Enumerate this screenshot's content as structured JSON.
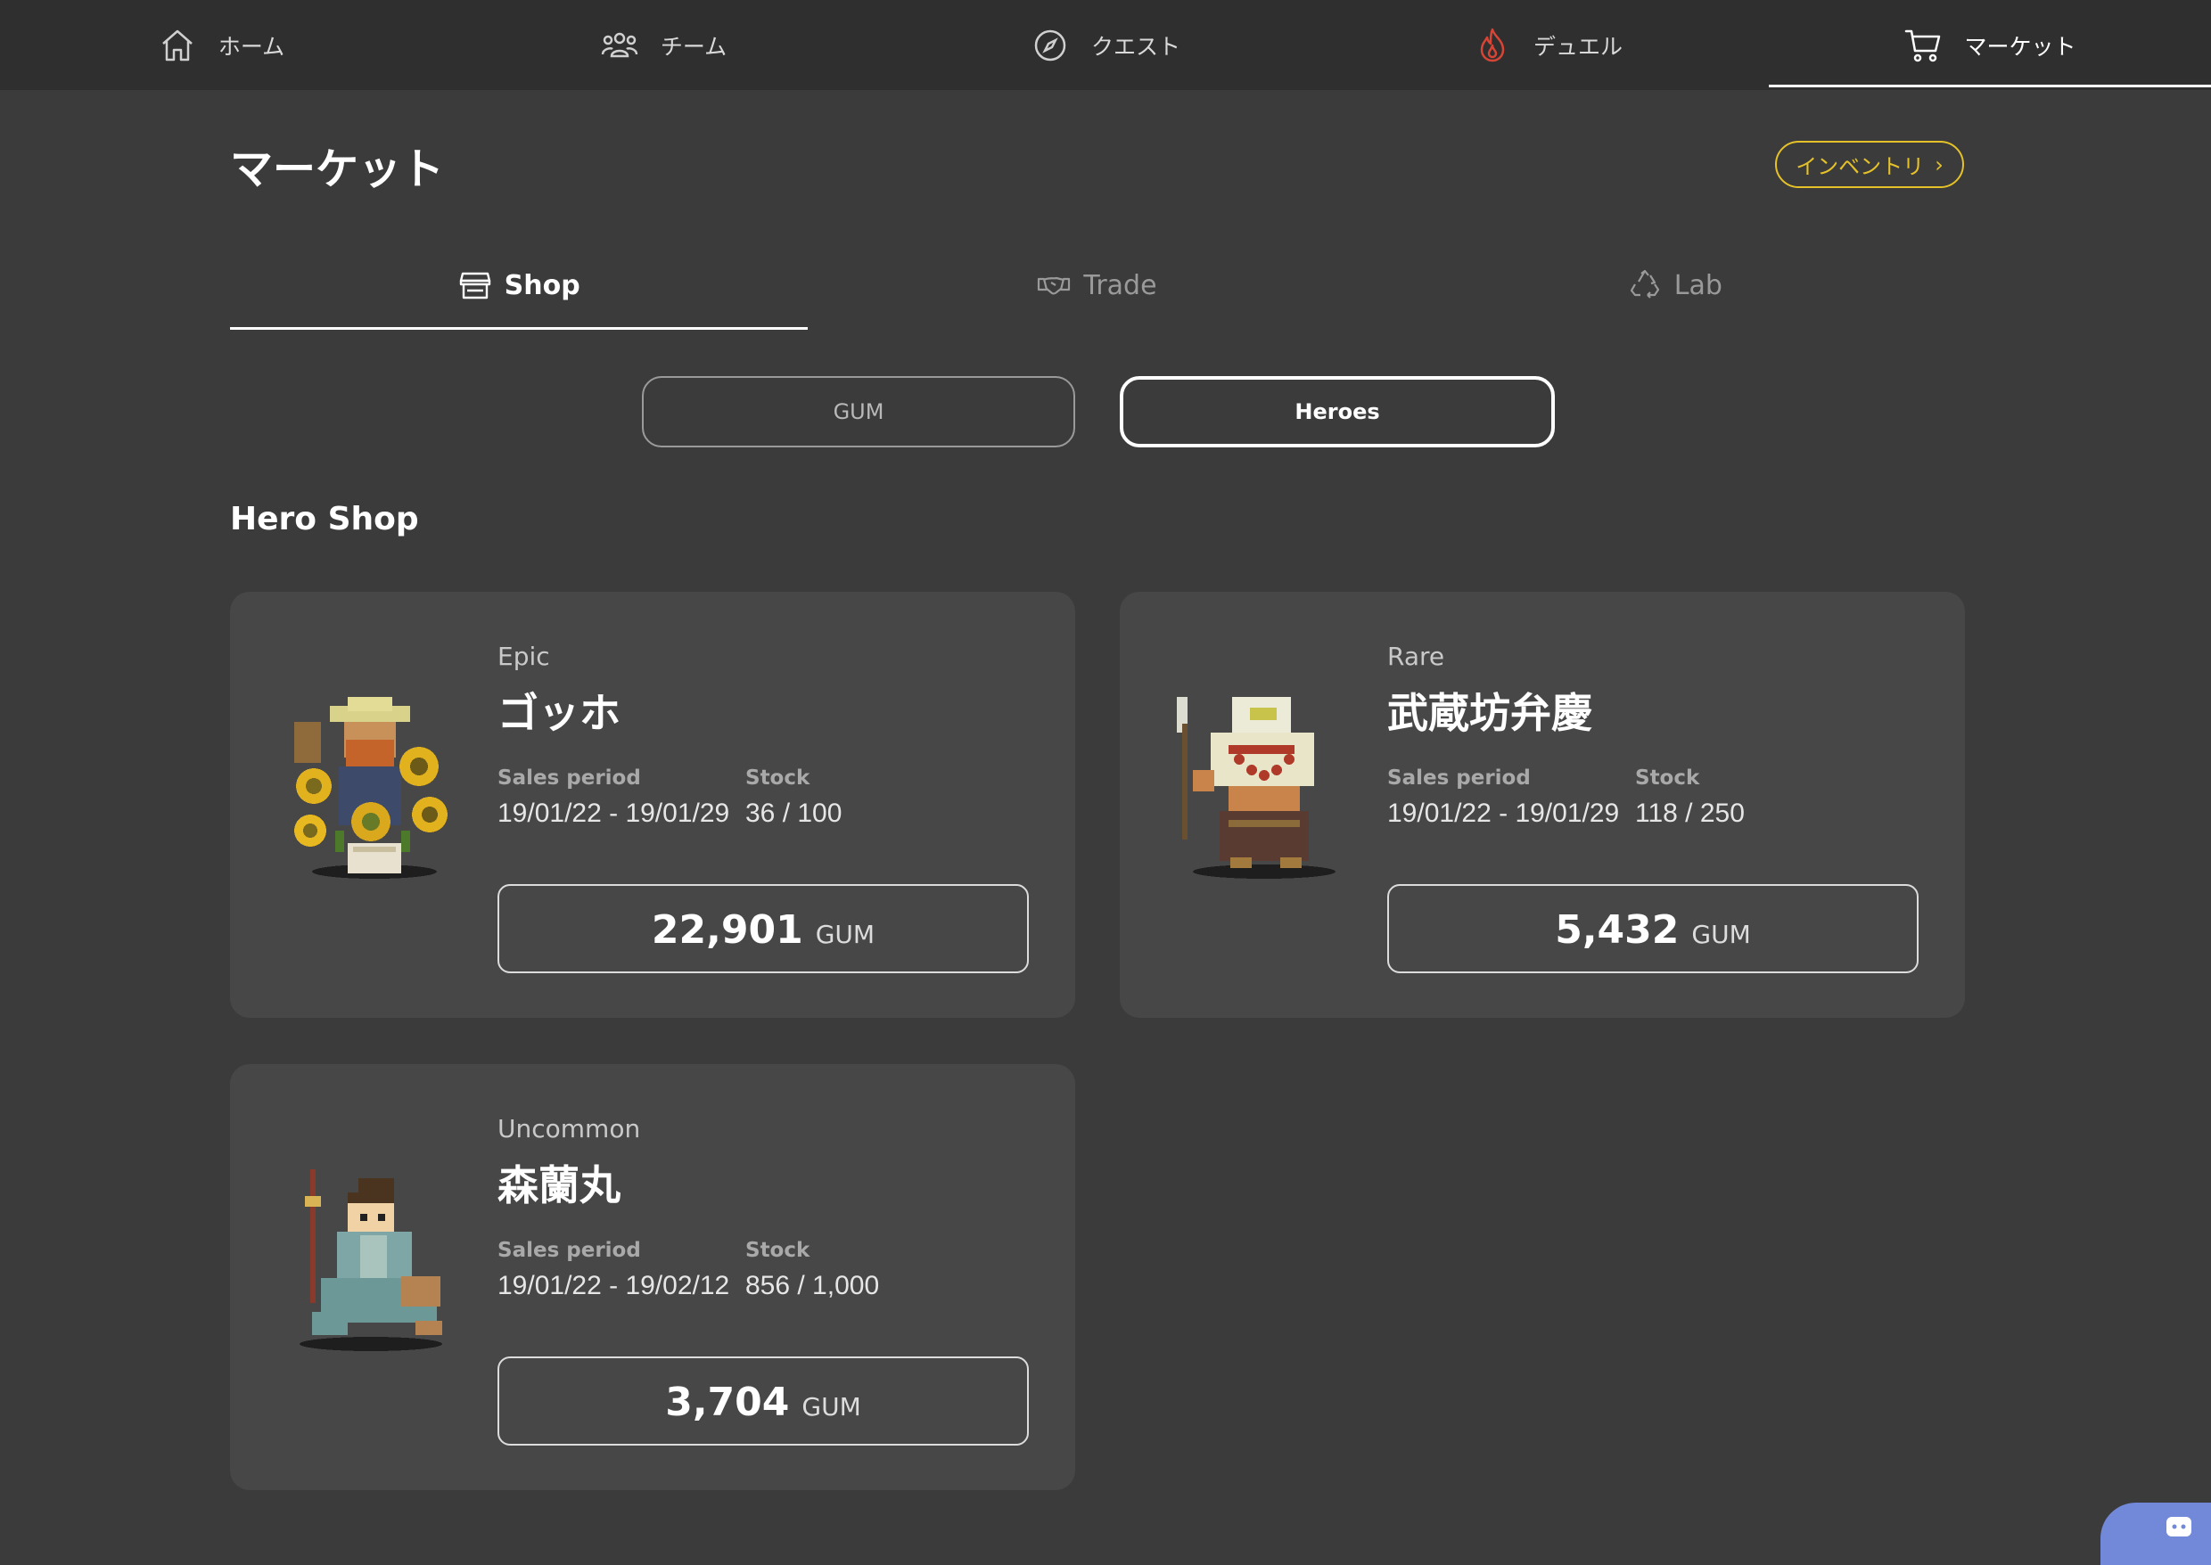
{
  "nav": {
    "items": [
      {
        "label": "ホーム",
        "icon": "home-icon"
      },
      {
        "label": "チーム",
        "icon": "team-icon"
      },
      {
        "label": "クエスト",
        "icon": "compass-icon"
      },
      {
        "label": "デュエル",
        "icon": "flame-icon"
      },
      {
        "label": "マーケット",
        "icon": "cart-icon",
        "active": true
      }
    ]
  },
  "header": {
    "title": "マーケット",
    "inventory_label": "インベントリ",
    "inventory_arrow": "›"
  },
  "tabs": [
    {
      "label": "Shop",
      "icon": "shop-icon",
      "active": true
    },
    {
      "label": "Trade",
      "icon": "handshake-icon"
    },
    {
      "label": "Lab",
      "icon": "recycle-icon"
    }
  ],
  "toggle": {
    "gum_label": "GUM",
    "heroes_label": "Heroes",
    "selected": "Heroes"
  },
  "section_title": "Hero Shop",
  "labels": {
    "sales_period": "Sales period",
    "stock": "Stock",
    "currency": "GUM"
  },
  "heroes": [
    {
      "rarity": "Epic",
      "name": "ゴッホ",
      "sales_period": "19/01/22 - 19/01/29",
      "stock": "36 / 100",
      "price": "22,901"
    },
    {
      "rarity": "Rare",
      "name": "武蔵坊弁慶",
      "sales_period": "19/01/22 - 19/01/29",
      "stock": "118 / 250",
      "price": "5,432"
    },
    {
      "rarity": "Uncommon",
      "name": "森蘭丸",
      "sales_period": "19/01/22 - 19/02/12",
      "stock": "856 / 1,000",
      "price": "3,704"
    }
  ],
  "colors": {
    "background": "#3b3b3b",
    "nav_background": "#2f2f2f",
    "card_background": "#474747",
    "accent_yellow": "#e6c229",
    "duel_red": "#d64535",
    "discord": "#7289da"
  }
}
